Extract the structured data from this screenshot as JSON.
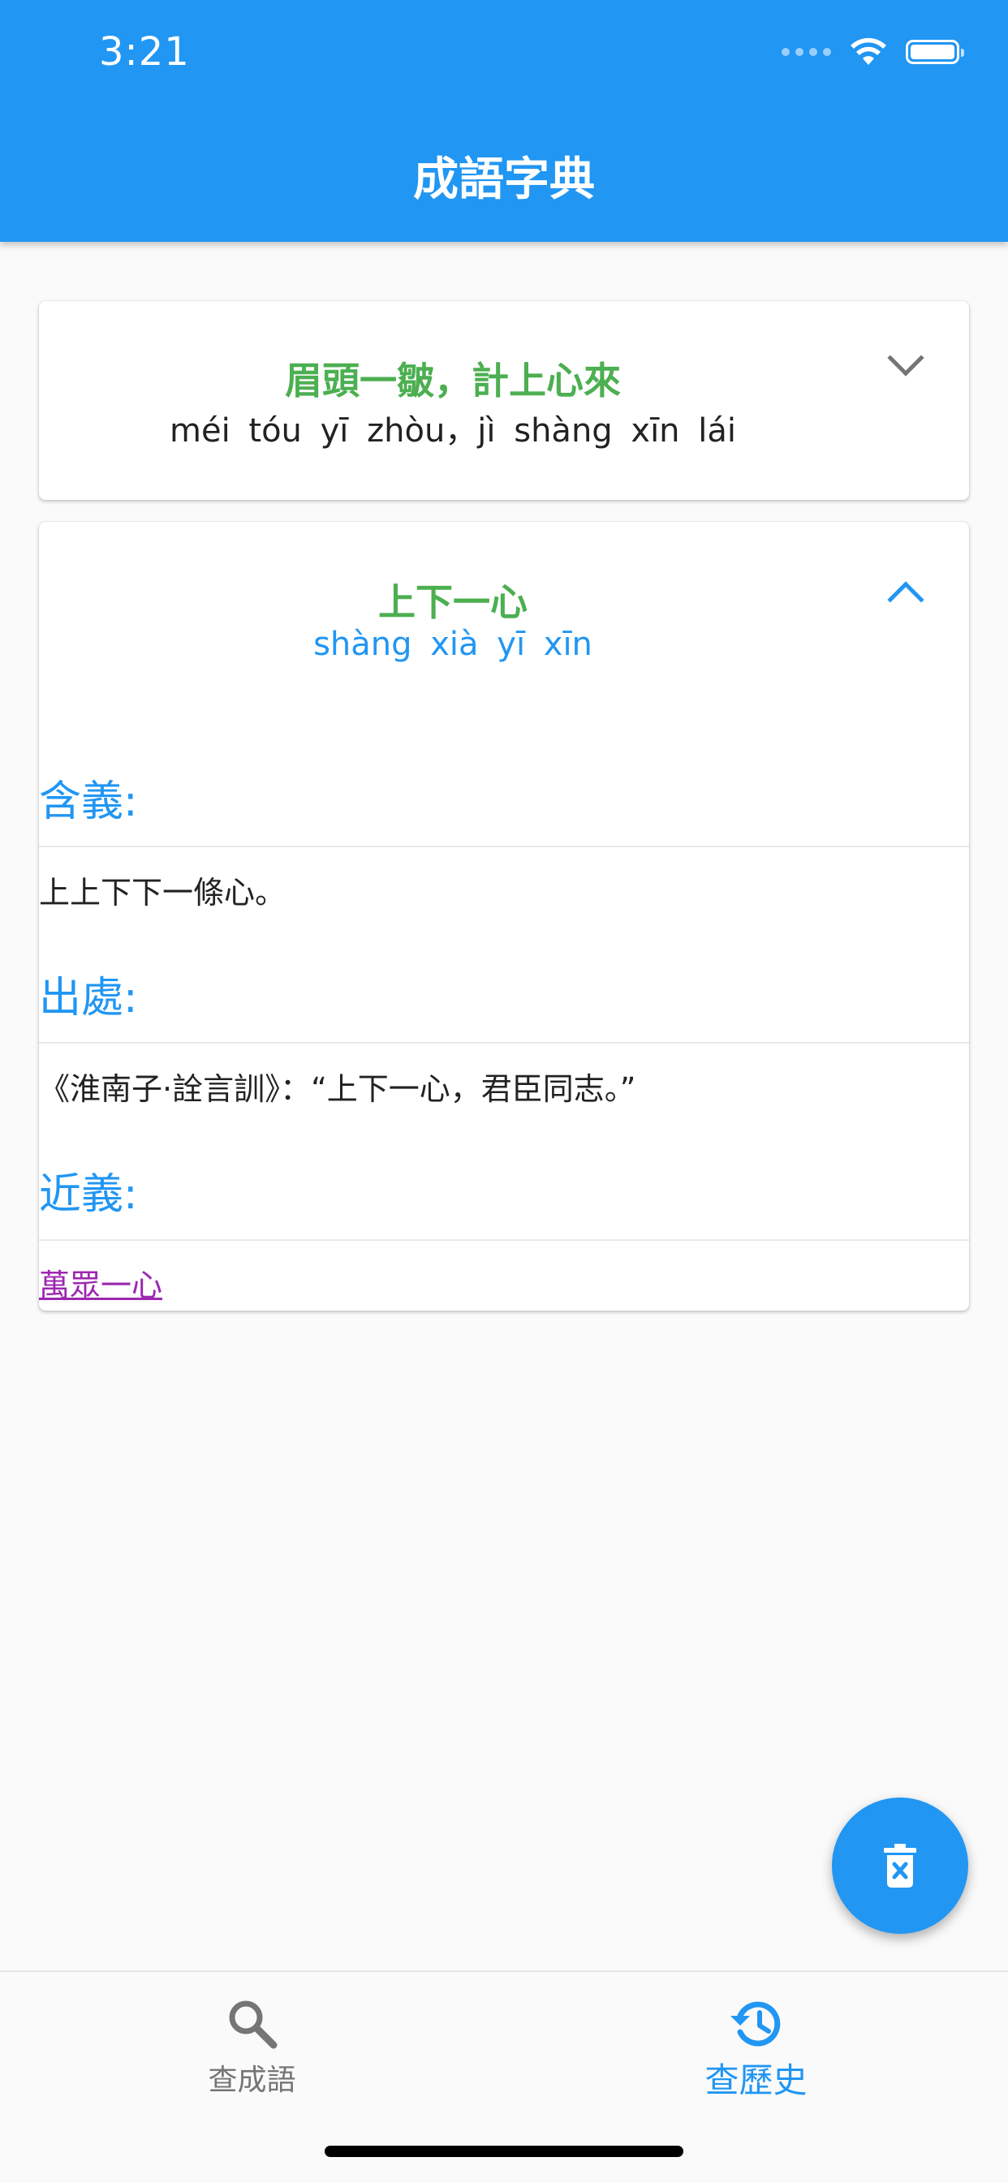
{
  "status_bar": {
    "time": "3:21"
  },
  "app_bar": {
    "title": "成語字典"
  },
  "history": [
    {
      "idiom": "眉頭一皺，計上心來",
      "pinyin": "méi tóu yī zhòu，jì shàng xīn lái",
      "expanded": false
    },
    {
      "idiom": "上下一心",
      "pinyin": "shàng xià yī xīn",
      "expanded": true,
      "meaning_label": "含義:",
      "meaning": "上上下下一條心。",
      "source_label": "出處:",
      "source": "《淮南子·詮言訓》：“上下一心，君臣同志。”",
      "synonym_label": "近義:",
      "synonyms": [
        "萬眾一心"
      ]
    }
  ],
  "fab": {
    "icon": "delete-icon"
  },
  "bottom_nav": {
    "items": [
      {
        "label": "查成語",
        "icon": "search-icon",
        "active": false
      },
      {
        "label": "查歷史",
        "icon": "history-icon",
        "active": true
      }
    ]
  },
  "colors": {
    "primary": "#2196f3",
    "idiom": "#4caf50",
    "link": "#9c27b0",
    "inactive": "#757575"
  }
}
